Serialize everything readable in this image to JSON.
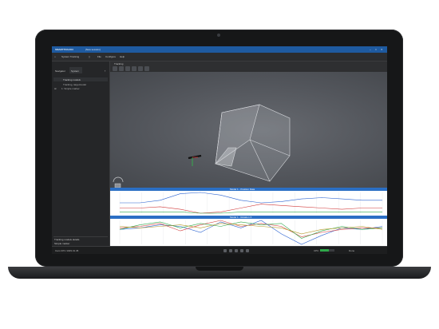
{
  "titlebar": {
    "app_name": "SMARTTRACK3",
    "session": "[New session]",
    "accent": "#1e5aa0"
  },
  "menubar": {
    "project_label": "System Tracking",
    "items": [
      "File",
      "Configure",
      "Help"
    ]
  },
  "toolbar": {
    "section_label": "Tracking"
  },
  "sidebar": {
    "tabs": [
      "Navigator",
      "System"
    ],
    "header": "Tracking models",
    "items": [
      "Tracking, targetmodel",
      "1: Simple marker"
    ],
    "details_title": "Tracking models details",
    "details_value": "Simple marker"
  },
  "charts": {
    "chart1_title": "Model 1 - Position Data",
    "chart2_title": "Model 1 - Rotation X",
    "colors": [
      "#2a62d0",
      "#d13a3a",
      "#2fa84a",
      "#b69a2a",
      "#8a3ab0"
    ]
  },
  "chart_data": [
    {
      "type": "line",
      "title": "Model 1 - Position Data",
      "series": [
        {
          "values": [
            0.2,
            0.2,
            0.4,
            0.9,
            1.0,
            0.8,
            0.4,
            0.2,
            0.3,
            0.5,
            0.6,
            0.5,
            0.4,
            0.4
          ]
        },
        {
          "values": [
            -0.2,
            -0.2,
            -0.1,
            -0.3,
            -0.6,
            -0.5,
            -0.2,
            0.1,
            0.0,
            -0.1,
            -0.2,
            -0.3,
            -0.2,
            -0.2
          ]
        },
        {
          "values": [
            -0.5,
            -0.5,
            -0.5,
            -0.5,
            -0.6,
            -0.6,
            -0.5,
            -0.5,
            -0.5,
            -0.5,
            -0.5,
            -0.5,
            -0.5,
            -0.5
          ]
        }
      ]
    },
    {
      "type": "line",
      "title": "Model 1 - Rotation X",
      "series": [
        {
          "values": [
            0.0,
            0.1,
            0.3,
            0.2,
            -0.2,
            0.5,
            0.1,
            0.6,
            -0.3,
            -1.0,
            -0.4,
            0.1,
            0.0,
            0.2
          ]
        },
        {
          "values": [
            0.1,
            0.2,
            0.4,
            -0.1,
            0.3,
            0.6,
            0.2,
            0.4,
            0.2,
            -0.5,
            -0.2,
            0.0,
            0.1,
            0.1
          ]
        },
        {
          "values": [
            0.0,
            0.3,
            0.5,
            0.1,
            0.4,
            0.2,
            0.5,
            0.3,
            0.4,
            -0.6,
            -0.1,
            0.2,
            0.0,
            0.1
          ]
        },
        {
          "values": [
            0.2,
            0.1,
            0.2,
            0.3,
            0.1,
            0.4,
            0.3,
            0.2,
            0.1,
            -0.3,
            0.0,
            0.1,
            0.2,
            0.0
          ]
        }
      ]
    }
  ],
  "statusbar": {
    "left_text": "Cam CPU 1029.31.45",
    "cpu_label": "CPU",
    "right_label": "Done"
  }
}
